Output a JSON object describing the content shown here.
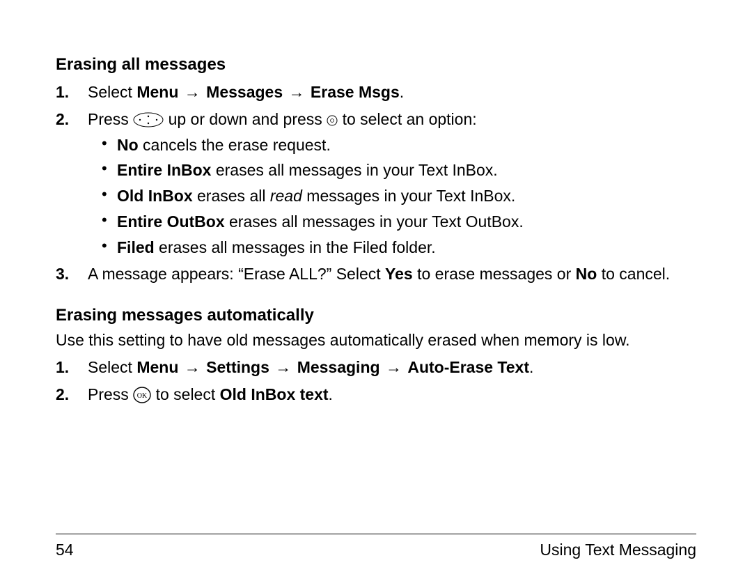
{
  "s1": {
    "heading": "Erasing all messages",
    "step1": {
      "lead": "Select ",
      "m1": "Menu",
      "arr": "→",
      "m2": "Messages",
      "m3": "Erase Msgs",
      "end": "."
    },
    "step2": {
      "lead": "Press ",
      "mid": " up or down and press ",
      "tail": " to select an option:"
    },
    "opts": {
      "no": {
        "b": "No",
        "t": " cancels the erase request."
      },
      "inbox": {
        "b": "Entire InBox",
        "t": " erases all messages in your Text InBox."
      },
      "oldinbox": {
        "b": "Old InBox",
        "t1": " erases all ",
        "em": "read",
        "t2": " messages in your Text InBox."
      },
      "outbox": {
        "b": "Entire OutBox",
        "t": " erases all messages in your Text OutBox."
      },
      "filed": {
        "b": "Filed",
        "t": " erases all messages in the Filed folder."
      }
    },
    "step3": {
      "a": "A message appears: “Erase ALL?” Select ",
      "yes": "Yes",
      "b": " to erase messages or ",
      "no": "No",
      "c": " to cancel."
    }
  },
  "s2": {
    "heading": "Erasing messages automatically",
    "intro": "Use this setting to have old messages automatically erased when memory is low.",
    "step1": {
      "lead": "Select ",
      "m1": "Menu",
      "m2": "Settings",
      "m3": "Messaging",
      "m4": "Auto-Erase Text",
      "arr": "→",
      "end": "."
    },
    "step2": {
      "lead": "Press ",
      "mid": " to select ",
      "bold": "Old InBox text",
      "end": "."
    }
  },
  "footer": {
    "page": "54",
    "chapter": "Using Text Messaging"
  }
}
